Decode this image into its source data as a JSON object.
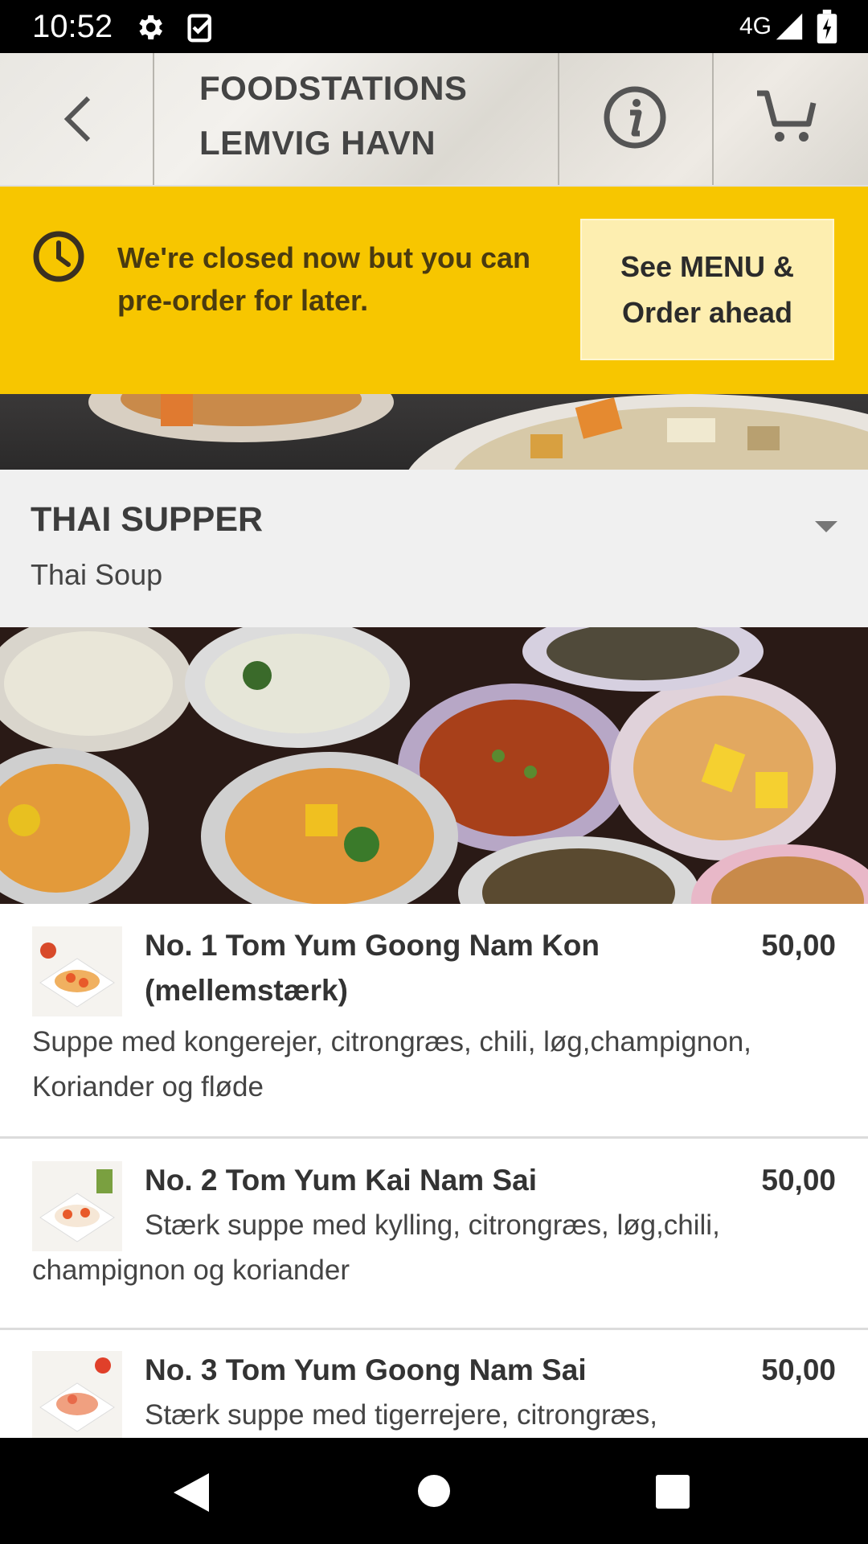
{
  "status_bar": {
    "time": "10:52",
    "network": "4G",
    "icons": [
      "gear-icon",
      "task-check-icon",
      "signal-icon",
      "battery-charging-icon"
    ]
  },
  "header": {
    "title_line1": "FOODSTATIONS",
    "title_line2": "LEMVIG HAVN",
    "icons": [
      "back-arrow-icon",
      "info-icon",
      "cart-icon"
    ]
  },
  "banner": {
    "message": "We're closed now but you can pre-order for later.",
    "button_label": "See MENU & Order ahead",
    "icon": "clock-icon",
    "color": "#f7c600"
  },
  "category": {
    "title": "THAI SUPPER",
    "subtitle": "Thai Soup",
    "icon": "caret-down-icon"
  },
  "menu": {
    "items": [
      {
        "name": "No. 1 Tom Yum Goong Nam Kon (mellemstærk)",
        "price": "50,00",
        "description": "Suppe med kongerejer, citrongræs, chili, løg,champignon, Koriander og fløde"
      },
      {
        "name": "No. 2 Tom Yum Kai Nam Sai",
        "price": "50,00",
        "description": "Stærk suppe med kylling, citrongræs, løg,chili, champignon og koriander"
      },
      {
        "name": "No. 3 Tom Yum Goong Nam Sai",
        "price": "50,00",
        "description": "Stærk suppe med tigerrejere, citrongræs,"
      }
    ]
  },
  "nav_bar": {
    "icons": [
      "nav-back-icon",
      "nav-home-icon",
      "nav-recents-icon"
    ]
  }
}
